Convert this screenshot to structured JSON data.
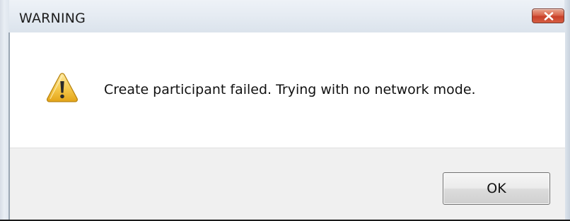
{
  "window": {
    "title": "WARNING",
    "close_icon": "close-x-icon"
  },
  "dialog": {
    "icon": "warning-triangle-icon",
    "message": "Create participant failed.  Trying with no network mode.",
    "ok_label": "OK"
  },
  "colors": {
    "close_button": "#d9644a",
    "warning_icon": "#f2c23a",
    "footer_background": "#f0f0f0"
  }
}
